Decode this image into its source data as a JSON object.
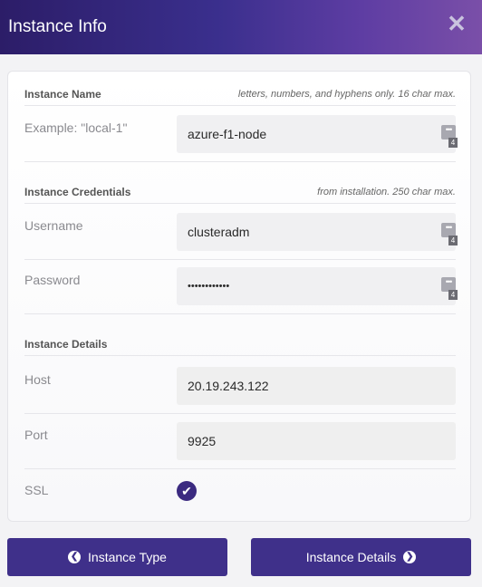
{
  "header": {
    "title": "Instance Info",
    "close_icon": "close-icon"
  },
  "sections": {
    "name": {
      "label": "Instance Name",
      "hint": "letters, numbers, and hyphens only. 16 char max."
    },
    "credentials": {
      "label": "Instance Credentials",
      "hint": "from installation. 250 char max."
    },
    "details": {
      "label": "Instance Details"
    }
  },
  "fields": {
    "name": {
      "label": "Example: \"local-1\"",
      "value": "azure-f1-node",
      "badge": "4"
    },
    "username": {
      "label": "Username",
      "value": "clusteradm",
      "badge": "4"
    },
    "password": {
      "label": "Password",
      "value": "••••••••••••",
      "badge": "4"
    },
    "host": {
      "label": "Host",
      "value": "20.19.243.122"
    },
    "port": {
      "label": "Port",
      "value": "9925"
    },
    "ssl": {
      "label": "SSL",
      "checked": true
    }
  },
  "buttons": {
    "back": {
      "label": "Instance Type",
      "icon": "chevron-left-icon"
    },
    "next": {
      "label": "Instance Details",
      "icon": "chevron-right-icon"
    }
  },
  "colors": {
    "accent": "#3f308a",
    "header_start": "#2c1d68",
    "header_end": "#7a4fa8"
  }
}
